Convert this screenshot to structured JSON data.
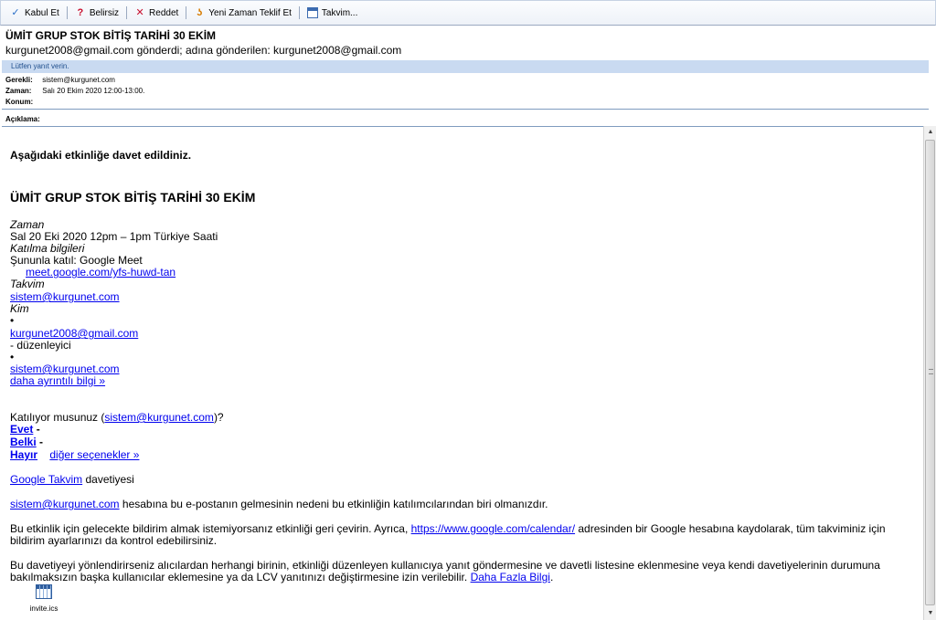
{
  "toolbar": {
    "accept": "Kabul Et",
    "tentative": "Belirsiz",
    "decline": "Reddet",
    "propose": "Yeni Zaman Teklif Et",
    "calendar": "Takvim..."
  },
  "header": {
    "subject": "ÜMİT GRUP STOK BİTİŞ TARİHİ 30 EKİM",
    "sender_line": "kurgunet2008@gmail.com gönderdi; adına gönderilen: kurgunet2008@gmail.com",
    "info_bar": "Lütfen yanıt verin.",
    "required_label": "Gerekli:",
    "required_value": "sistem@kurgunet.com",
    "when_label": "Zaman:",
    "when_value": "Salı 20 Ekim 2020 12:00-13:00.",
    "location_label": "Konum:",
    "location_value": "",
    "description_label": "Açıklama:"
  },
  "body": {
    "invited_line": "Aşağıdaki etkinliğe davet edildiniz.",
    "event_title": "ÜMİT GRUP STOK BİTİŞ TARİHİ 30 EKİM",
    "when_heading": "Zaman",
    "when_text": "Sal 20 Eki 2020 12pm – 1pm Türkiye Saati",
    "join_heading": "Katılma bilgileri",
    "join_with": "Şununla katıl: Google Meet",
    "meet_link": "meet.google.com/yfs-huwd-tan",
    "calendar_heading": "Takvim",
    "calendar_link": "sistem@kurgunet.com",
    "who_heading": "Kim",
    "bullet": "•",
    "guest1": "kurgunet2008@gmail.com",
    "organizer_note": "- düzenleyici",
    "guest2": "sistem@kurgunet.com",
    "more_details": "daha ayrıntılı bilgi »",
    "attending_prefix": "Katılıyor musunuz (",
    "attending_email": "sistem@kurgunet.com",
    "attending_suffix": ")?",
    "yes": "Evet",
    "maybe": "Belki",
    "no": "Hayır",
    "dash": " -",
    "other_options": "diğer seçenekler »",
    "google_calendar": "Google Takvim",
    "invite_word": " davetiyesi",
    "reason_email": "sistem@kurgunet.com",
    "reason_text": " hesabına bu e-postanın gelmesinin nedeni bu etkinliğin katılımcılarından biri olmanızdır.",
    "notify_text1": "Bu etkinlik için gelecekte bildirim almak istemiyorsanız etkinliği geri çevirin. Ayrıca, ",
    "notify_link": "https://www.google.com/calendar/",
    "notify_text2": " adresinden bir Google hesabına kaydolarak, tüm takviminiz için bildirim ayarlarınızı da kontrol edebilirsiniz.",
    "forward_text": "Bu davetiyeyi yönlendirirseniz alıcılardan herhangi birinin, etkinliği düzenleyen kullanıcıya yanıt göndermesine ve davetli listesine eklenmesine veya kendi davetiyelerinin durumuna bakılmaksızın başka kullanıcılar eklemesine ya da LCV yanıtınızı değiştirmesine izin verilebilir. ",
    "learn_more": "Daha Fazla Bilgi",
    "period": "."
  },
  "attachment": {
    "name": "invite.ics"
  }
}
